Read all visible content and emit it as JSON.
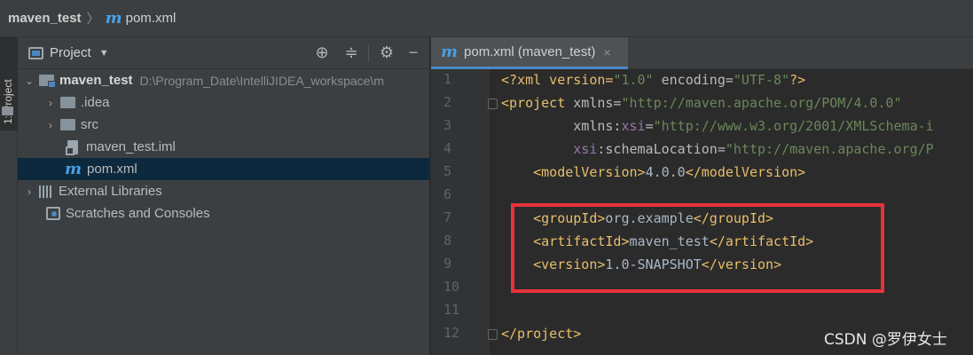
{
  "breadcrumb": {
    "project": "maven_test",
    "separator": "〉",
    "file_icon": "m",
    "file": "pom.xml"
  },
  "tool_strip": {
    "project_tab": "1: Project"
  },
  "project_panel": {
    "title": "Project",
    "tree": [
      {
        "label": "maven_test",
        "path": "D:\\Program_Date\\IntelliJIDEA_workspace\\m",
        "icon": "module-folder-icon"
      },
      {
        "label": ".idea",
        "icon": "folder-icon"
      },
      {
        "label": "src",
        "icon": "folder-icon"
      },
      {
        "label": "maven_test.iml",
        "icon": "iml-file-icon"
      },
      {
        "label": "pom.xml",
        "icon": "maven-icon",
        "selected": true
      },
      {
        "label": "External Libraries",
        "icon": "library-icon"
      },
      {
        "label": "Scratches and Consoles",
        "icon": "scratch-icon"
      }
    ]
  },
  "editor": {
    "tab": {
      "label": "pom.xml (maven_test)",
      "close": "×"
    },
    "line_numbers": [
      "1",
      "2",
      "3",
      "4",
      "5",
      "6",
      "7",
      "8",
      "9",
      "10",
      "11",
      "12"
    ],
    "code": {
      "l1": {
        "a": "<?xml version=",
        "b": "\"1.0\"",
        "c": " encoding=",
        "d": "\"UTF-8\"",
        "e": "?>"
      },
      "l2": {
        "a": "<project ",
        "b": "xmlns=",
        "c": "\"http://maven.apache.org/POM/4.0.0\""
      },
      "l3": {
        "a": "xmlns:",
        "b": "xsi",
        "c": "=",
        "d": "\"http://www.w3.org/2001/XMLSchema-i"
      },
      "l4": {
        "a": "xsi",
        "b": ":schemaLocation=",
        "c": "\"http://maven.apache.org/P"
      },
      "l5": {
        "a": "<modelVersion>",
        "b": "4.0.0",
        "c": "</modelVersion>"
      },
      "l7": {
        "a": "<groupId>",
        "b": "org.example",
        "c": "</groupId>"
      },
      "l8": {
        "a": "<artifactId>",
        "b": "maven_test",
        "c": "</artifactId>"
      },
      "l9": {
        "a": "<version>",
        "b": "1.0-SNAPSHOT",
        "c": "</version>"
      },
      "l12": {
        "a": "</project>"
      }
    }
  },
  "watermark": "CSDN @罗伊女士",
  "colors": {
    "highlight_box": "#e8323a",
    "tag": "#e8bf6a",
    "string": "#6a8759",
    "namespace": "#9876aa",
    "maven_icon": "#4a9fe6"
  }
}
